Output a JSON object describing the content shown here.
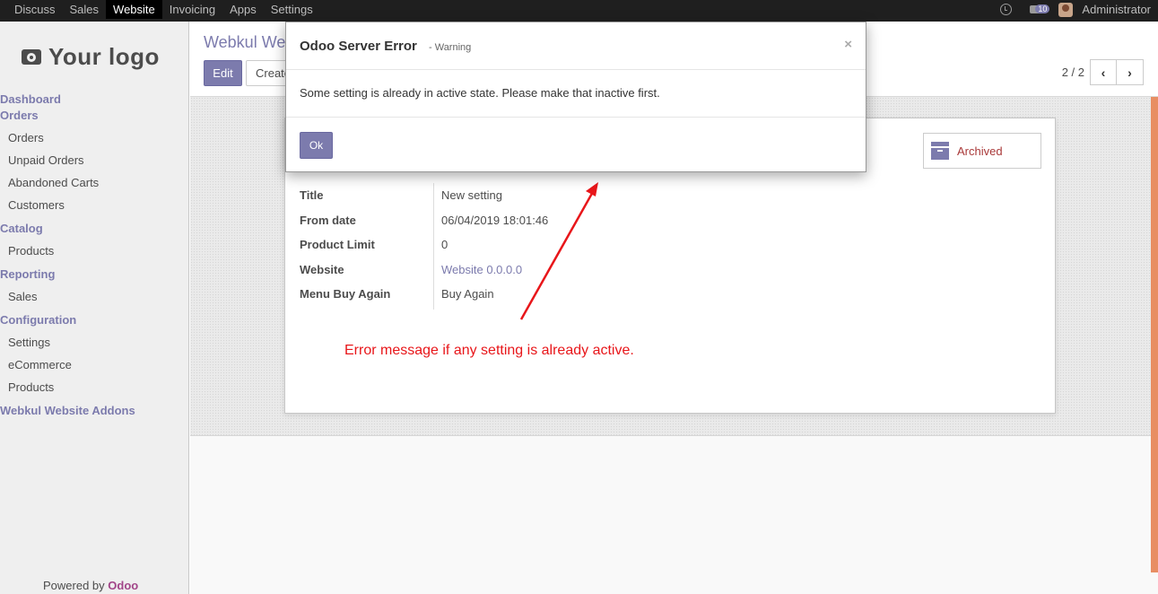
{
  "topbar": {
    "menu": [
      "Discuss",
      "Sales",
      "Website",
      "Invoicing",
      "Apps",
      "Settings"
    ],
    "active": "Website",
    "chat_count": "10",
    "user": "Administrator"
  },
  "sidebar": {
    "logo_text": "Your logo",
    "sections": [
      {
        "heading": "Dashboard",
        "items": []
      },
      {
        "heading": "Orders",
        "items": [
          "Orders",
          "Unpaid Orders",
          "Abandoned Carts",
          "Customers"
        ]
      },
      {
        "heading": "Catalog",
        "items": [
          "Products"
        ]
      },
      {
        "heading": "Reporting",
        "items": [
          "Sales"
        ]
      },
      {
        "heading": "Configuration",
        "items": [
          "Settings",
          "eCommerce",
          "Products"
        ]
      },
      {
        "heading": "Webkul Website Addons",
        "items": []
      }
    ],
    "powered_by": "Powered by",
    "powered_brand": "Odoo"
  },
  "control": {
    "breadcrumb": "Webkul We",
    "edit_label": "Edit",
    "create_label": "Create",
    "pager": "2 / 2",
    "prev": "‹",
    "next": "›"
  },
  "record": {
    "archived_label": "Archived",
    "fields": [
      {
        "label": "Title",
        "value": "New setting",
        "link": false
      },
      {
        "label": "From date",
        "value": "06/04/2019 18:01:46",
        "link": false
      },
      {
        "label": "Product Limit",
        "value": "0",
        "link": false
      },
      {
        "label": "Website",
        "value": "Website 0.0.0.0",
        "link": true
      },
      {
        "label": "Menu Buy Again",
        "value": "Buy Again",
        "link": false
      }
    ]
  },
  "annotation": "Error message if any setting is already active.",
  "modal": {
    "title": "Odoo Server Error",
    "subtitle": "- Warning",
    "close": "×",
    "body": "Some setting is already in active state. Please make that inactive first.",
    "ok_label": "Ok"
  },
  "colors": {
    "accent": "#7c7bad",
    "annotation": "#e8161a",
    "archived": "#a93939"
  }
}
